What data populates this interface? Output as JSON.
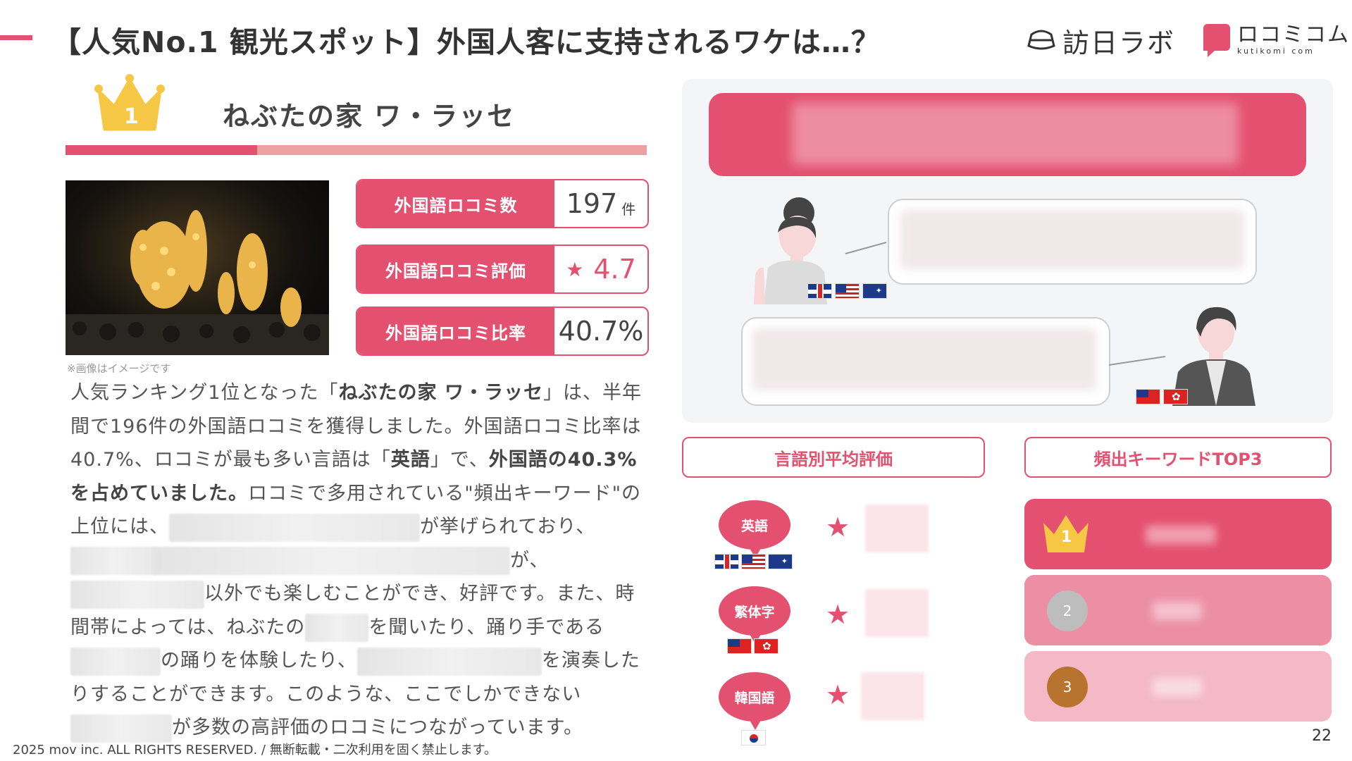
{
  "header": {
    "title": "【人気No.1 観光スポット】外国人客に支持されるワケは…？",
    "logo_visit_japan": "訪日ラボ",
    "logo_kutikomi_main": "ロコミコム",
    "logo_kutikomi_sub": "kutikomi com"
  },
  "rank": {
    "number": "1",
    "name": "ねぶたの家 ワ・ラッセ"
  },
  "photo_caption": "※画像はイメージです",
  "stats": [
    {
      "label": "外国語ロコミ数",
      "value": "197",
      "unit": "件"
    },
    {
      "label": "外国語ロコミ評価",
      "value": "4.7",
      "icon": "star-icon"
    },
    {
      "label": "外国語ロコミ比率",
      "value": "40.7%"
    }
  ],
  "body": {
    "p1": "人気ランキング1位となった「",
    "p1_bold": "ねぶたの家 ワ・ラッセ",
    "p2": "」は、半年間で196件の外国語ロコミを獲得しました。外国語ロコミ比率は40.7%、ロコミが最も多い言語は「",
    "p2_bold": "英語",
    "p3": "」で、",
    "p3_bold": "外国語の40.3%を占めていました。",
    "p4": "ロコミで多用されている\"頻出キーワード\"の上位には、",
    "p5": "が挙げられており、",
    "p6": "が、",
    "p7": "以外でも楽しむことができ、好評です。また、時間帯によっては、ねぶたの",
    "p8": "を聞いたり、踊り手である",
    "p9": "の踊りを体験したり、",
    "p10": "を演奏したりすることができます。このような、ここでしかできない",
    "p11": "が多数の高評価のロコミにつながっています。"
  },
  "sections": {
    "lang_rating_title": "言語別平均評価",
    "keywords_title": "頻出キーワードTOP3"
  },
  "languages": [
    {
      "name": "英語",
      "flags": [
        "uk-flag",
        "us-flag",
        "au-flag"
      ]
    },
    {
      "name": "繁体字",
      "flags": [
        "tw-flag",
        "hk-flag"
      ]
    },
    {
      "name": "韓国語",
      "flags": [
        "kr-flag"
      ]
    }
  ],
  "keywords": [
    {
      "rank": "1"
    },
    {
      "rank": "2"
    },
    {
      "rank": "3"
    }
  ],
  "colors": {
    "accent": "#e4506f",
    "accent_light": "#eca0a0",
    "kw2": "#ec8fa4",
    "kw3": "#f4b8c6",
    "gold": "#f6c745",
    "silver": "#bdbdbd",
    "bronze": "#b8742e"
  },
  "footer": {
    "copyright": "2025 mov inc. ALL RIGHTS RESERVED. / 無断転載・二次利用を固く禁止します。",
    "page_number": "22"
  }
}
